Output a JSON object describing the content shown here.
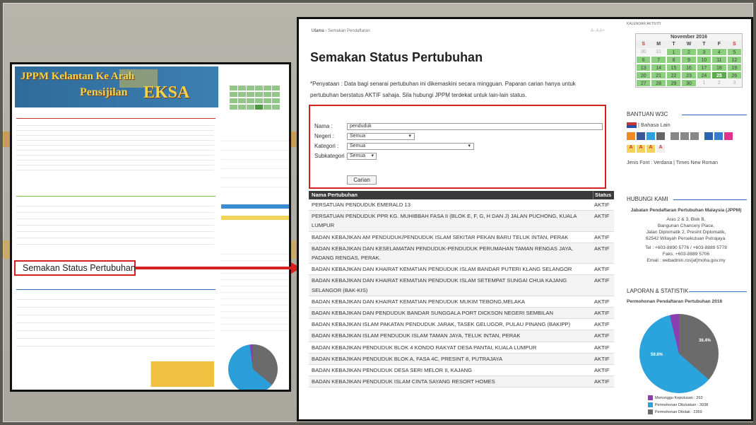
{
  "small_shot": {
    "banner_line1": "JPPM Kelantan Ke Arah",
    "banner_line2": "Pensijilan",
    "banner_line3": "EKSA",
    "callout": "Semakan Status Pertubuhan"
  },
  "main": {
    "breadcrumb_home": "Utama",
    "breadcrumb_current": "Semakan Pendaftaran",
    "breadcrumb_icons": "A- A A+",
    "title": "Semakan Status Pertubuhan",
    "note": "*Penyataan : Data bagi senarai pertubuhan ini dikemaskini secara mingguan. Paparan carian hanya untuk pertubuhan berstatus AKTIF sahaja. Sila hubungi JPPM terdekat untuk lain-lain status.",
    "form": {
      "nama_label": "Nama :",
      "nama_value": "penduduk",
      "negeri_label": "Negeri :",
      "negeri_value": "Semua",
      "kategori_label": "Kategori :",
      "kategori_value": "Semua",
      "subkategori_label": "Subkategori :",
      "subkategori_value": "Semua",
      "submit": "Carian"
    },
    "table": {
      "col_name": "Nama Pertubuhan",
      "col_status": "Status",
      "rows": [
        {
          "name": "PERSATUAN PENDUDUK EMERALD 13",
          "status": "AKTIF"
        },
        {
          "name": "PERSATUAN PENDUDUK PPR KG. MUHIBBAH FASA II (BLOK E, F, G, H DAN J) JALAN PUCHONG, KUALA LUMPUR",
          "status": "AKTIF"
        },
        {
          "name": "BADAN KEBAJIKAN AM PENDUDUK/PENDUDUK ISLAM SEKITAR PEKAN BARU TELUK INTAN, PERAK",
          "status": "AKTIF"
        },
        {
          "name": "BADAN KEBAJIKAN DAN KESELAMATAN PENDUDUK-PENDUDUK PERUMAHAN TAMAN RENGAS JAYA, PADANG RENGAS, PERAK.",
          "status": "AKTIF"
        },
        {
          "name": "BADAN KEBAJIKAN DAN KHAIRAT KEMATIAN PENDUDUK ISLAM BANDAR PUTERI KLANG SELANGOR",
          "status": "AKTIF"
        },
        {
          "name": "BADAN KEBAJIKAN DAN KHAIRAT KEMATIAN PENDUDUK ISLAM SETEMPAT SUNGAI CHUA KAJANG SELANGOR (BAK-KIS)",
          "status": "AKTIF"
        },
        {
          "name": "BADAN KEBAJIKAN DAN KHAIRAT KEMATIAN PENDUDUK MUKIM TEBONG,MELAKA",
          "status": "AKTIF"
        },
        {
          "name": "BADAN KEBAJIKAN DAN PENDUDUK BANDAR SUNGGALA PORT DICKSON NEGERI SEMBILAN",
          "status": "AKTIF"
        },
        {
          "name": "BADAN KEBAJIKAN ISLAM PAKATAN PENDUDUK JARAK, TASEK GELUGOR, PULAU PINANG (BAKIPP)",
          "status": "AKTIF"
        },
        {
          "name": "BADAN KEBAJIKAN ISLAM PENDUDUK ISLAM TAMAN JAYA, TELUK INTAN, PERAK",
          "status": "AKTIF"
        },
        {
          "name": "BADAN KEBAJIKAN PENDUDUK BLOK 4 KONDO RAKYAT DESA PANTAI, KUALA LUMPUR",
          "status": "AKTIF"
        },
        {
          "name": "BADAN KEBAJIKAN PENDUDUK BLOK A, FASA 4C, PRESINT 8, PUTRAJAYA",
          "status": "AKTIF"
        },
        {
          "name": "BADAN KEBAJIKAN PENDUDUK DESA SERI MELOR II, KAJANG",
          "status": "AKTIF"
        },
        {
          "name": "BADAN KEBAJIKAN PENDUDUK ISLAM CINTA SAYANG RESORT HOMES",
          "status": "AKTIF"
        }
      ]
    }
  },
  "sidebar": {
    "calendar_head": "KALENDAR AKTIVITI",
    "calendar_month": "November 2016",
    "days": [
      "S",
      "M",
      "T",
      "W",
      "T",
      "F",
      "S"
    ],
    "cells": [
      "30",
      "31",
      "1",
      "2",
      "3",
      "4",
      "5",
      "6",
      "7",
      "8",
      "9",
      "10",
      "11",
      "12",
      "13",
      "14",
      "15",
      "16",
      "17",
      "18",
      "19",
      "20",
      "21",
      "22",
      "23",
      "24",
      "25",
      "26",
      "27",
      "28",
      "29",
      "30",
      "1",
      "2",
      "3"
    ],
    "w3c_head": "BANTUAN W3C",
    "bahasa": "| Bahasa Lain",
    "font_row": "Jenis Font : Verdana | Times New Roman",
    "font_sizes": [
      "A",
      "A",
      "A",
      "A"
    ],
    "contact_head": "HUBUNGI KAMI",
    "contact_org": "Jabatan Pendaftaran Pertubuhan Malaysia (JPPM)",
    "contact_addr1": "Aras 2 & 3, Blok B,",
    "contact_addr2": "Bangunan Chancery Place,",
    "contact_addr3": "Jalan Diplomatik 2, Presint Diplomatik,",
    "contact_addr4": "62542 Wilayah Persekutuan Putrajaya.",
    "contact_tel": "Tel : +603-8890 5776 / +603-8889 5778",
    "contact_fax": "Faks: +603-8889 5706",
    "contact_email": "Email : webadmin.ros[at]moha.gov.my",
    "stats_head": "LAPORAN & STATISTIK",
    "chart_title": "Permohonan Pendaftaran Pertubuhan 2016",
    "pie_label_blue": "59.8%",
    "pie_label_grey": "36.4%",
    "legend": [
      "Menunggu Keputusan : 263",
      "Permohonan Diluluskan : 3938",
      "Permohonan Ditolak : 2359"
    ],
    "colors": {
      "grey": "#6b6b6b",
      "blue": "#2ba3dc",
      "purple": "#8a3fb0"
    }
  }
}
